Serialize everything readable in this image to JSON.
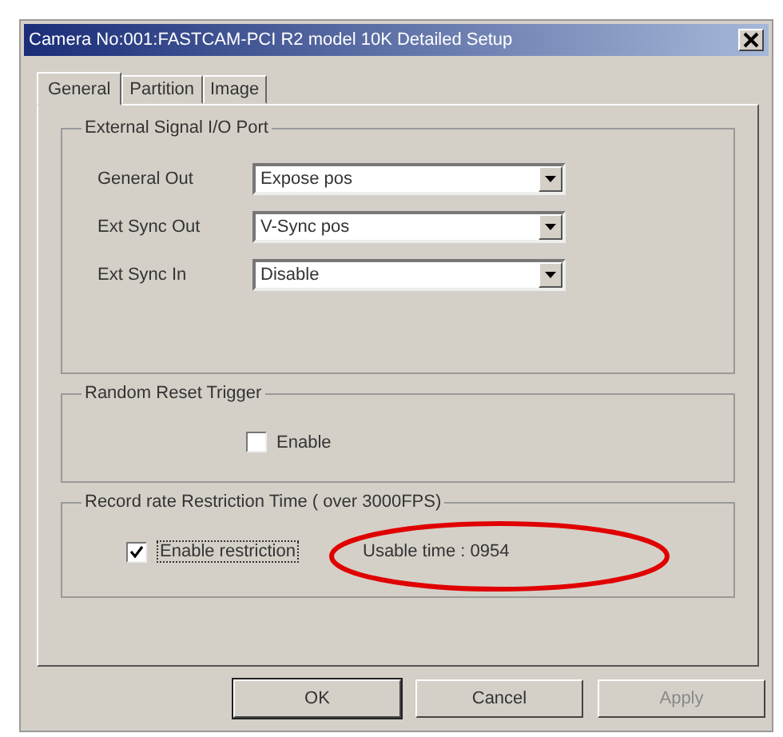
{
  "window": {
    "title": "Camera No:001:FASTCAM-PCI R2 model 10K Detailed Setup"
  },
  "tabs": [
    {
      "label": "General",
      "selected": true
    },
    {
      "label": "Partition",
      "selected": false
    },
    {
      "label": "Image",
      "selected": false
    }
  ],
  "external_signal": {
    "title": "External Signal I/O Port",
    "fields": [
      {
        "label": "General Out",
        "value": "Expose pos"
      },
      {
        "label": "Ext Sync Out",
        "value": "V-Sync pos"
      },
      {
        "label": "Ext Sync In",
        "value": "Disable"
      }
    ]
  },
  "random_reset": {
    "title": "Random Reset Trigger",
    "checkbox": {
      "label": "Enable",
      "checked": false
    }
  },
  "record_rate": {
    "title": "Record rate Restriction Time ( over 3000FPS)",
    "checkbox": {
      "label": "Enable restriction",
      "checked": true
    },
    "usable_time": "Usable time : 0954"
  },
  "buttons": [
    {
      "label": "OK",
      "disabled": false
    },
    {
      "label": "Cancel",
      "disabled": false
    },
    {
      "label": "Apply",
      "disabled": true
    }
  ]
}
